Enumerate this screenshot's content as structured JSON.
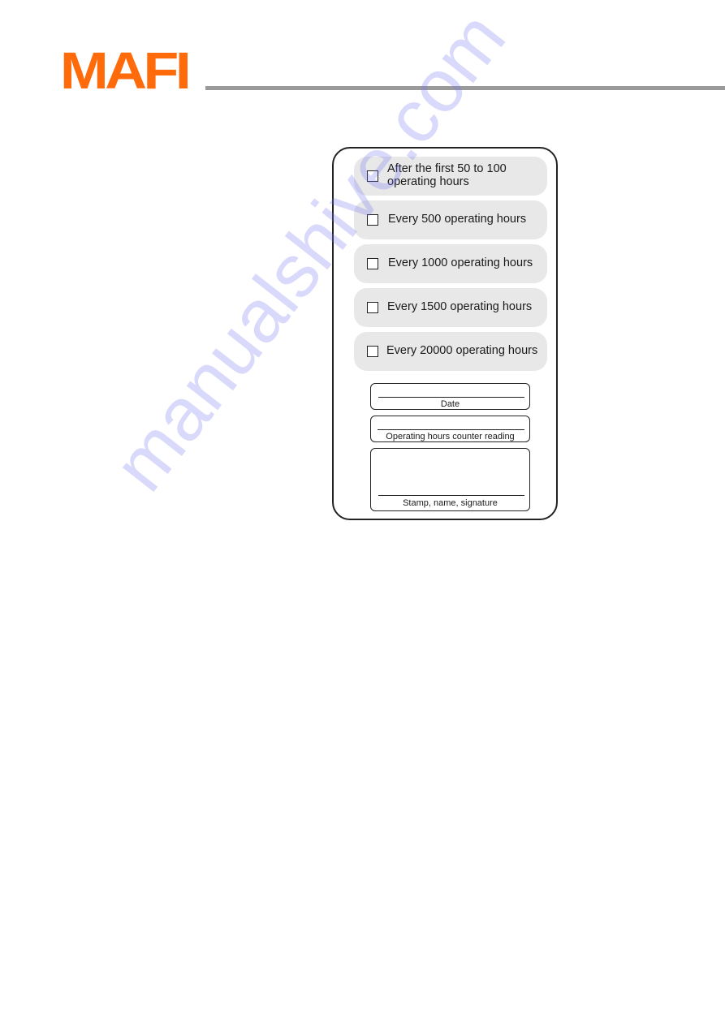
{
  "header": {
    "brand": "MAFI",
    "brand_color": "#ff6a0a",
    "rule_color": "#9a9a9a"
  },
  "maintenance_card": {
    "intervals": [
      {
        "label_line1": "After the first 50 to 100",
        "label_line2": "operating hours",
        "checked": false
      },
      {
        "label": "Every 500 operating hours",
        "checked": false
      },
      {
        "label": "Every 1000 operating hours",
        "checked": false
      },
      {
        "label": "Every 1500 operating hours",
        "checked": false
      },
      {
        "label": "Every 20000 operating hours",
        "checked": false
      }
    ],
    "fields": {
      "date": {
        "label": "Date",
        "value": ""
      },
      "hours_counter": {
        "label": "Operating hours counter reading",
        "value": ""
      },
      "signature": {
        "label": "Stamp, name, signature",
        "value": ""
      }
    }
  },
  "watermark": {
    "text": "manualshive.com"
  }
}
